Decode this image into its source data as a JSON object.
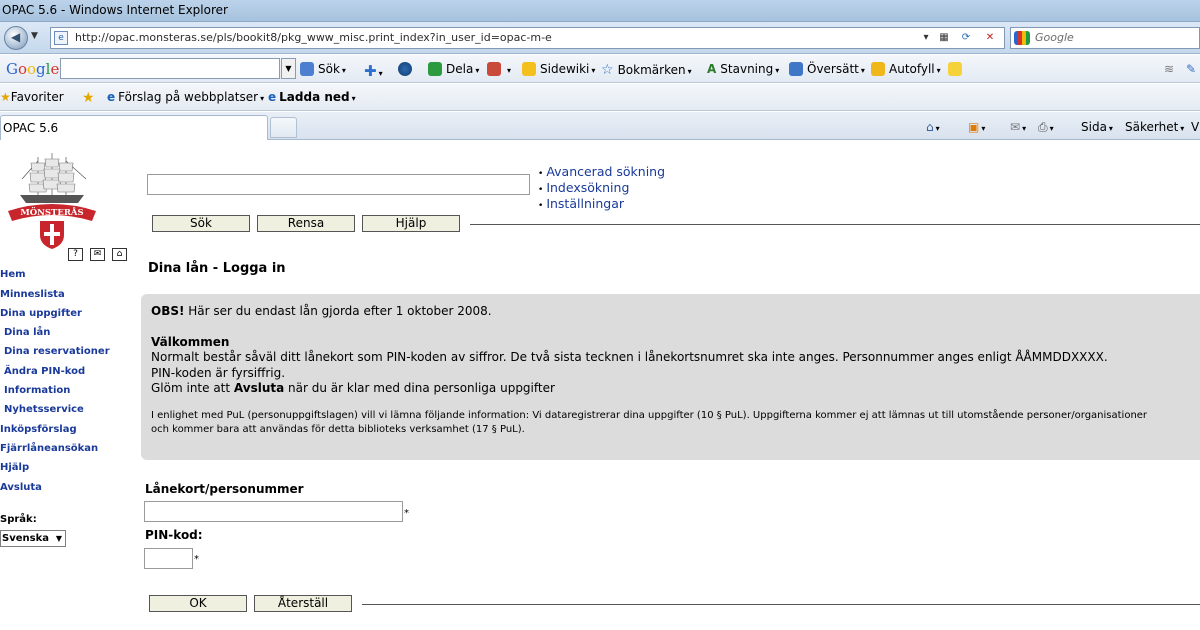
{
  "window": {
    "title": "OPAC 5.6 - Windows Internet Explorer"
  },
  "address_bar": {
    "url": "http://opac.monsteras.se/pls/bookit8/pkg_www_misc.print_index?in_user_id=opac-m-e",
    "search_placeholder": "Google"
  },
  "google_toolbar": {
    "logo": "Google",
    "items": [
      "Sök",
      "Dela",
      "Sidewiki",
      "Bokmärken",
      "Stavning",
      "Översätt",
      "Autofyll"
    ]
  },
  "favorites_bar": {
    "favorites_label": "Favoriter",
    "suggested_sites": "Förslag på webbplatser",
    "download": "Ladda ned"
  },
  "tabs": {
    "active_tab": "OPAC 5.6",
    "commands": [
      "Sida",
      "Säkerhet",
      "V"
    ]
  },
  "page": {
    "logo_text": "MÖNSTERÅS",
    "search": {
      "value": "",
      "links": [
        "Avancerad sökning",
        "Indexsökning",
        "Inställningar"
      ],
      "buttons": {
        "search": "Sök",
        "clear": "Rensa",
        "help": "Hjälp"
      }
    },
    "icon_boxes": [
      "?",
      "✉",
      "⌂"
    ],
    "nav": [
      {
        "label": "Hem",
        "sub": false
      },
      {
        "label": "Minneslista",
        "sub": false
      },
      {
        "label": "Dina uppgifter",
        "sub": false
      },
      {
        "label": "Dina lån",
        "sub": true
      },
      {
        "label": "Dina reservationer",
        "sub": true
      },
      {
        "label": "Ändra PIN-kod",
        "sub": true
      },
      {
        "label": "Information",
        "sub": true
      },
      {
        "label": "Nyhetsservice",
        "sub": true
      },
      {
        "label": "Inköpsförslag",
        "sub": false
      },
      {
        "label": "Fjärrlåneansökan",
        "sub": false
      },
      {
        "label": "Hjälp",
        "sub": false
      },
      {
        "label": "Avsluta",
        "sub": false
      }
    ],
    "language": {
      "label": "Språk:",
      "selected": "Svenska"
    },
    "heading": "Dina lån - Logga in",
    "info": {
      "obs_label": "OBS!",
      "obs_text": " Här ser du endast lån gjorda efter 1 oktober 2008.",
      "welcome": "Välkommen",
      "line1": "Normalt består såväl ditt lånekort som PIN-koden av siffror. De två sista tecknen i lånekortsnumret ska inte anges. Personnummer anges enligt ÅÅMMDDXXXX.",
      "line2": "PIN-koden är fyrsiffrig.",
      "line3_pre": "Glöm inte att ",
      "line3_bold": "Avsluta",
      "line3_post": " när du är klar med dina personliga uppgifter",
      "pul1": "I enlighet med PuL (personuppgiftslagen) vill vi lämna följande information: Vi dataregistrerar dina uppgifter (10 § PuL). Uppgifterna kommer ej att lämnas ut till utomstående personer/organisationer",
      "pul2": "och kommer bara att användas för detta biblioteks verksamhet (17 § PuL)."
    },
    "login": {
      "card_label": "Lånekort/personummer",
      "card_value": "",
      "pin_label": "PIN-kod:",
      "pin_value": "",
      "required_mark": "*",
      "ok": "OK",
      "reset": "Återställ"
    }
  }
}
